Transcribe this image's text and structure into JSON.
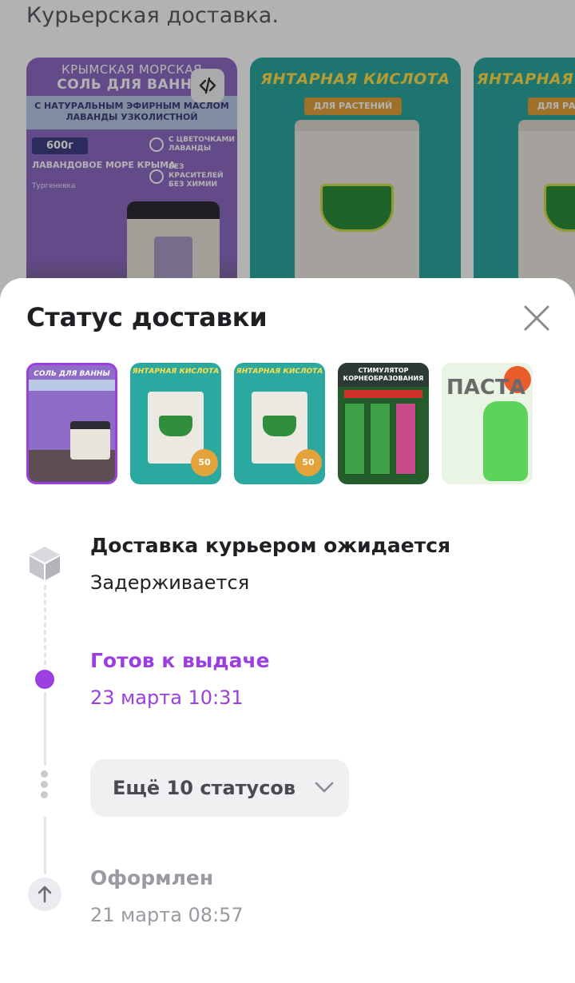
{
  "background": {
    "heading": "Курьерская доставка.",
    "cards": [
      {
        "type": "salt",
        "line1": "КРЫМСКАЯ МОРСКАЯ",
        "line2": "СОЛЬ ДЛЯ ВАННЫ",
        "band": "С НАТУРАЛЬНЫМ ЭФИРНЫМ МАСЛОМ ЛАВАНДЫ УЗКОЛИСТНОЙ",
        "weight": "600г",
        "sub": "ЛАВАНДОВОЕ МОРЕ КРЫМА",
        "sub2": "Тургеневка",
        "feature1": "С ЦВЕТОЧКАМИ ЛАВАНДЫ",
        "feature2": "БЕЗ КРАСИТЕЛЕЙ БЕЗ ХИМИИ",
        "compare_icon": "compare-icon"
      },
      {
        "type": "acid",
        "title": "ЯНТАРНАЯ КИСЛОТА",
        "pill": "ДЛЯ РАСТЕНИЙ"
      },
      {
        "type": "acid",
        "title": "ЯНТАРНАЯ КИСЛОТА",
        "pill": "ДЛЯ РАСТЕНИЙ"
      }
    ]
  },
  "sheet": {
    "title": "Статус доставки",
    "close_icon": "close-icon",
    "thumbnails": [
      {
        "kind": "salt",
        "text": "СОЛЬ ДЛЯ ВАННЫ",
        "selected": true
      },
      {
        "kind": "acid",
        "text": "ЯНТАРНАЯ КИСЛОТА",
        "badge": "50",
        "selected": false
      },
      {
        "kind": "acid",
        "text": "ЯНТАРНАЯ КИСЛОТА",
        "badge": "50",
        "selected": false
      },
      {
        "kind": "stim",
        "text": "СТИМУЛЯТОР КОРНЕОБРАЗОВАНИЯ",
        "selected": false
      },
      {
        "kind": "paste",
        "text": "ПАСТА",
        "selected": false
      }
    ],
    "timeline": [
      {
        "title": "Доставка курьером ожидается",
        "subtitle": "Задерживается",
        "state": "pending",
        "icon": "box-icon"
      },
      {
        "title": "Готов к выдаче",
        "subtitle": "23 марта 10:31",
        "state": "active"
      },
      {
        "title": "Оформлен",
        "subtitle": "21 марта 08:57",
        "state": "done",
        "icon": "arrow-up-icon"
      }
    ],
    "more_button": {
      "label": "Ещё 10 статусов",
      "icon": "chevron-down-icon"
    }
  },
  "colors": {
    "accent": "#9b3fe0",
    "text": "#1f1f24",
    "muted": "#9a9aa2",
    "overlay": "rgba(0,0,0,0.30)"
  }
}
